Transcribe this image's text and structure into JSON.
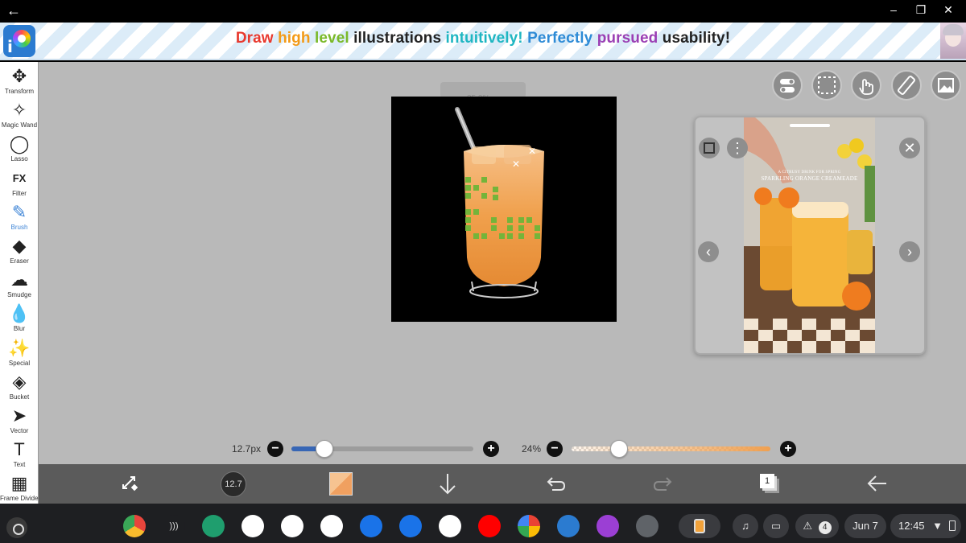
{
  "window": {
    "back_icon": "arrow-left-icon",
    "controls": [
      "minimize-icon",
      "restore-icon",
      "close-icon"
    ]
  },
  "banner": {
    "words": [
      {
        "text": "Draw",
        "color": "#e8392e"
      },
      {
        "text": "high",
        "color": "#f39a17"
      },
      {
        "text": "level",
        "color": "#7ab928"
      },
      {
        "text": "illustrations",
        "color": "#222222"
      },
      {
        "text": "intuitively!",
        "color": "#1fb6c2"
      },
      {
        "text": "Perfectly",
        "color": "#2e8bd6"
      },
      {
        "text": "pursued",
        "color": "#9b3fb4"
      },
      {
        "text": "usability",
        "color": "#222222"
      },
      {
        "text": "!",
        "color": "#222222"
      }
    ]
  },
  "tools": [
    {
      "label": "Transform",
      "icon": "✥"
    },
    {
      "label": "Magic Wand",
      "icon": "✧"
    },
    {
      "label": "Lasso",
      "icon": "◯"
    },
    {
      "label": "Filter",
      "icon": "FX"
    },
    {
      "label": "Brush",
      "icon": "✎"
    },
    {
      "label": "Eraser",
      "icon": "◆"
    },
    {
      "label": "Smudge",
      "icon": "☁"
    },
    {
      "label": "Blur",
      "icon": "💧"
    },
    {
      "label": "Special",
      "icon": "✨"
    },
    {
      "label": "Bucket",
      "icon": "◈"
    },
    {
      "label": "Vector",
      "icon": "➤"
    },
    {
      "label": "Text",
      "icon": "T"
    },
    {
      "label": "Frame Divider",
      "icon": "▦"
    }
  ],
  "active_tool": "Brush",
  "canvas": {
    "zoom_label": "25.0%"
  },
  "reference": {
    "caption_small": "A CITRUSY DRINK FOR SPRING",
    "caption": "SPARKLING ORANGE CREAMEADE"
  },
  "brush": {
    "size_label": "12.7px",
    "size_fraction": 0.18
  },
  "opacity": {
    "label": "24%",
    "fraction": 0.24
  },
  "bottom": {
    "brush_size_value": "12.7",
    "layer_count": "1"
  },
  "shelf": {
    "date": "Jun 7",
    "time": "12:45",
    "notification_count": "4",
    "apps": [
      {
        "name": "chrome-icon",
        "color": "#e8453c"
      },
      {
        "name": "cast-icon",
        "color": "#1e1f22"
      },
      {
        "name": "apps-icon",
        "color": "#1f9e6e"
      },
      {
        "name": "gmail-icon",
        "color": "#ffffff"
      },
      {
        "name": "play-store-icon",
        "color": "#ffffff"
      },
      {
        "name": "calendar-icon",
        "color": "#ffffff"
      },
      {
        "name": "files-icon",
        "color": "#1a73e8"
      },
      {
        "name": "messages-icon",
        "color": "#1a73e8"
      },
      {
        "name": "meet-icon",
        "color": "#ffffff"
      },
      {
        "name": "youtube-icon",
        "color": "#ff0000"
      },
      {
        "name": "photos-icon",
        "color": "#ffffff"
      },
      {
        "name": "ibispaint-icon",
        "color": "#2b7bd0"
      },
      {
        "name": "game-icon",
        "color": "#9b3fd4"
      },
      {
        "name": "settings-icon",
        "color": "#5f6368"
      }
    ]
  }
}
